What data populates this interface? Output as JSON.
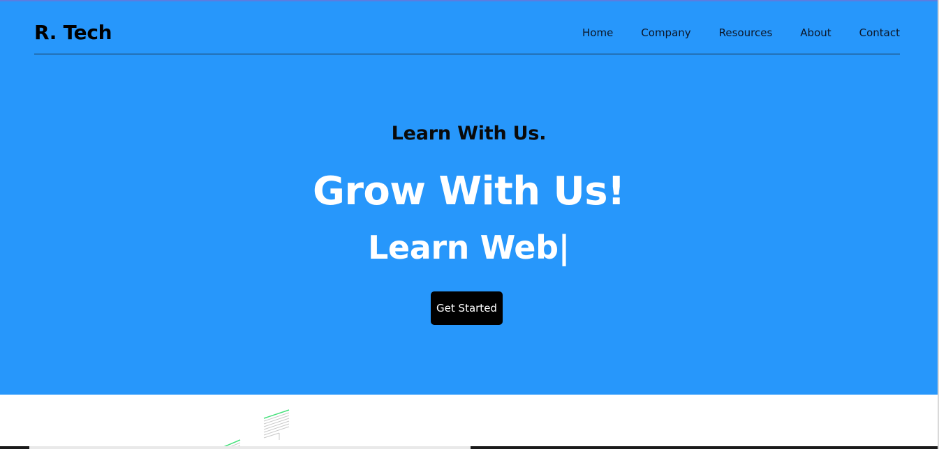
{
  "brand": {
    "name": "R. Tech"
  },
  "nav": {
    "items": [
      {
        "label": "Home"
      },
      {
        "label": "Company"
      },
      {
        "label": "Resources"
      },
      {
        "label": "About"
      },
      {
        "label": "Contact"
      }
    ]
  },
  "hero": {
    "kicker": "Learn With Us.",
    "headline": "Grow With Us!",
    "typed_text": "Learn Web|",
    "cta_label": "Get Started"
  },
  "colors": {
    "hero_background": "#2797fb",
    "cta_background": "#000000",
    "headline_text": "#ffffff",
    "illustration_accent": "#45e07a"
  },
  "icons": {
    "below_fold_illustration": "isometric-lines-illustration"
  }
}
